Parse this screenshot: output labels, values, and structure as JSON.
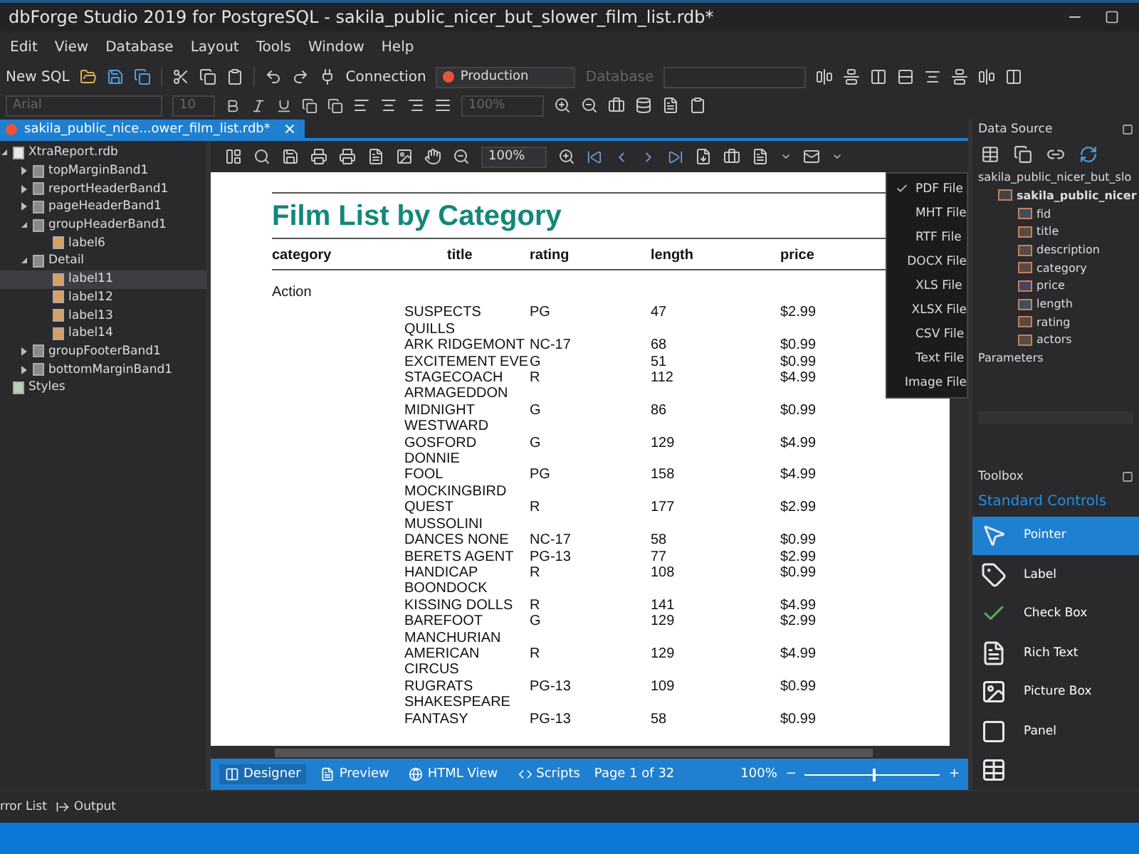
{
  "window": {
    "title": "dbForge Studio 2019 for PostgreSQL - sakila_public_nicer_but_slower_film_list.rdb*"
  },
  "menu": [
    "Edit",
    "View",
    "Database",
    "Layout",
    "Tools",
    "Window",
    "Help"
  ],
  "toolbar": {
    "new_sql": "New SQL",
    "connection_label": "Connection",
    "connection": "Production",
    "database_label": "Database",
    "font": "Arial",
    "font_size": "10",
    "zoom": "100%"
  },
  "document_tab": {
    "title": "sakila_public_nice...ower_film_list.rdb*",
    "close": "×"
  },
  "report_tree": [
    {
      "label": "XtraReport.rdb",
      "kind": "report",
      "selected": false,
      "expanded": true,
      "children": [
        {
          "label": "topMarginBand1",
          "kind": "band",
          "selected": false,
          "expanded": false
        },
        {
          "label": "reportHeaderBand1",
          "kind": "band",
          "selected": false,
          "expanded": false
        },
        {
          "label": "pageHeaderBand1",
          "kind": "band",
          "selected": false,
          "expanded": false
        },
        {
          "label": "groupHeaderBand1",
          "kind": "band",
          "selected": false,
          "expanded": true,
          "children": [
            {
              "label": "label6",
              "kind": "label",
              "selected": false
            }
          ]
        },
        {
          "label": "Detail",
          "kind": "band",
          "selected": false,
          "expanded": true,
          "children": [
            {
              "label": "label11",
              "kind": "label",
              "selected": true
            },
            {
              "label": "label12",
              "kind": "label",
              "selected": false
            },
            {
              "label": "label13",
              "kind": "label",
              "selected": false
            },
            {
              "label": "label14",
              "kind": "label",
              "selected": false
            }
          ]
        },
        {
          "label": "groupFooterBand1",
          "kind": "band",
          "selected": false,
          "expanded": false
        },
        {
          "label": "bottomMarginBand1",
          "kind": "band",
          "selected": false,
          "expanded": false
        }
      ]
    },
    {
      "label": "Styles",
      "kind": "styles",
      "selected": false
    }
  ],
  "preview_toolbar": {
    "zoom": "100%"
  },
  "export_menu": [
    {
      "label": "PDF File",
      "checked": true
    },
    {
      "label": "MHT File",
      "checked": false
    },
    {
      "label": "RTF File",
      "checked": false
    },
    {
      "label": "DOCX File",
      "checked": false
    },
    {
      "label": "XLS File",
      "checked": false
    },
    {
      "label": "XLSX File",
      "checked": false
    },
    {
      "label": "CSV File",
      "checked": false
    },
    {
      "label": "Text File",
      "checked": false
    },
    {
      "label": "Image File",
      "checked": false
    }
  ],
  "report": {
    "title": "Film List by Category",
    "columns": [
      "category",
      "title",
      "rating",
      "length",
      "price"
    ],
    "group": "Action",
    "rows": [
      {
        "title": "SUSPECTS QUILLS",
        "rating": "PG",
        "length": "47",
        "price": "$2.99"
      },
      {
        "title": "ARK RIDGEMONT",
        "rating": "NC-17",
        "length": "68",
        "price": "$0.99"
      },
      {
        "title": "EXCITEMENT EVE",
        "rating": "G",
        "length": "51",
        "price": "$0.99"
      },
      {
        "title": "STAGECOACH ARMAGEDDON",
        "rating": "R",
        "length": "112",
        "price": "$4.99"
      },
      {
        "title": "MIDNIGHT WESTWARD",
        "rating": "G",
        "length": "86",
        "price": "$0.99"
      },
      {
        "title": "GOSFORD DONNIE",
        "rating": "G",
        "length": "129",
        "price": "$4.99"
      },
      {
        "title": "FOOL MOCKINGBIRD",
        "rating": "PG",
        "length": "158",
        "price": "$4.99"
      },
      {
        "title": "QUEST MUSSOLINI",
        "rating": "R",
        "length": "177",
        "price": "$2.99"
      },
      {
        "title": "DANCES NONE",
        "rating": "NC-17",
        "length": "58",
        "price": "$0.99"
      },
      {
        "title": "BERETS AGENT",
        "rating": "PG-13",
        "length": "77",
        "price": "$2.99"
      },
      {
        "title": "HANDICAP BOONDOCK",
        "rating": "R",
        "length": "108",
        "price": "$0.99"
      },
      {
        "title": "KISSING DOLLS",
        "rating": "R",
        "length": "141",
        "price": "$4.99"
      },
      {
        "title": "BAREFOOT MANCHURIAN",
        "rating": "G",
        "length": "129",
        "price": "$2.99"
      },
      {
        "title": "AMERICAN CIRCUS",
        "rating": "R",
        "length": "129",
        "price": "$4.99"
      },
      {
        "title": "RUGRATS SHAKESPEARE",
        "rating": "PG-13",
        "length": "109",
        "price": "$0.99"
      },
      {
        "title": "FANTASY",
        "rating": "PG-13",
        "length": "58",
        "price": "$0.99"
      }
    ]
  },
  "status_bar": {
    "tabs": [
      {
        "label": "Designer",
        "kind": "designer",
        "selected": true
      },
      {
        "label": "Preview",
        "kind": "preview",
        "selected": false
      },
      {
        "label": "HTML View",
        "kind": "html",
        "selected": false
      },
      {
        "label": "Scripts",
        "kind": "scripts",
        "selected": false
      }
    ],
    "page": "Page 1 of 32",
    "zoom": "100%",
    "zoom_out": "−",
    "zoom_in": "+",
    "zoom_slider": {
      "level": 0.5
    }
  },
  "data_source": {
    "title": "Data Source",
    "tree": [
      {
        "label": "sakila_public_nicer_but_slo",
        "bold": false,
        "children": [
          {
            "label": "sakila_public_nicer",
            "kind": "table",
            "bold": true,
            "children": [
              {
                "label": "fid",
                "kind": "number"
              },
              {
                "label": "title",
                "kind": "text"
              },
              {
                "label": "description",
                "kind": "text"
              },
              {
                "label": "category",
                "kind": "text"
              },
              {
                "label": "price",
                "kind": "decimal"
              },
              {
                "label": "length",
                "kind": "number"
              },
              {
                "label": "rating",
                "kind": "text"
              },
              {
                "label": "actors",
                "kind": "text"
              }
            ]
          }
        ]
      },
      {
        "label": "Parameters",
        "bold": false
      }
    ]
  },
  "toolbox": {
    "title": "Toolbox",
    "group": "Standard Controls",
    "items": [
      {
        "label": "Pointer",
        "kind": "pointer",
        "selected": true
      },
      {
        "label": "Label",
        "kind": "label",
        "selected": false
      },
      {
        "label": "Check Box",
        "kind": "checkbox",
        "selected": false
      },
      {
        "label": "Rich Text",
        "kind": "richtext",
        "selected": false
      },
      {
        "label": "Picture Box",
        "kind": "picture",
        "selected": false
      },
      {
        "label": "Panel",
        "kind": "panel",
        "selected": false
      },
      {
        "kind": "table",
        "selected": false
      }
    ]
  },
  "bottom_tabs": [
    "rror List",
    "Output"
  ]
}
